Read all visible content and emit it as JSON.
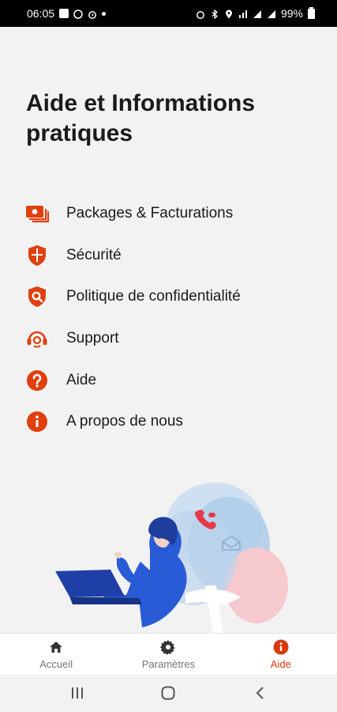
{
  "status_bar": {
    "time": "06:05",
    "battery": "99%"
  },
  "page": {
    "title": "Aide et Informations pratiques"
  },
  "menu": {
    "items": [
      {
        "label": "Packages & Facturations",
        "icon": "billing-icon"
      },
      {
        "label": "Sécurité",
        "icon": "shield-icon"
      },
      {
        "label": "Politique de confidentialité",
        "icon": "privacy-shield-icon"
      },
      {
        "label": "Support",
        "icon": "support-headset-icon"
      },
      {
        "label": "Aide",
        "icon": "question-icon"
      },
      {
        "label": "A propos de nous",
        "icon": "info-icon"
      }
    ]
  },
  "bottom_nav": {
    "items": [
      {
        "label": "Accueil",
        "icon": "home-icon",
        "active": false
      },
      {
        "label": "Paramètres",
        "icon": "gear-icon",
        "active": false
      },
      {
        "label": "Aide",
        "icon": "info-icon",
        "active": true
      }
    ]
  },
  "colors": {
    "accent": "#e0400e",
    "active_label": "#d63a10",
    "illustration_blue": "#2a5bd7",
    "illustration_light_blue": "#aecbe8",
    "illustration_pink": "#f6c9cf"
  }
}
